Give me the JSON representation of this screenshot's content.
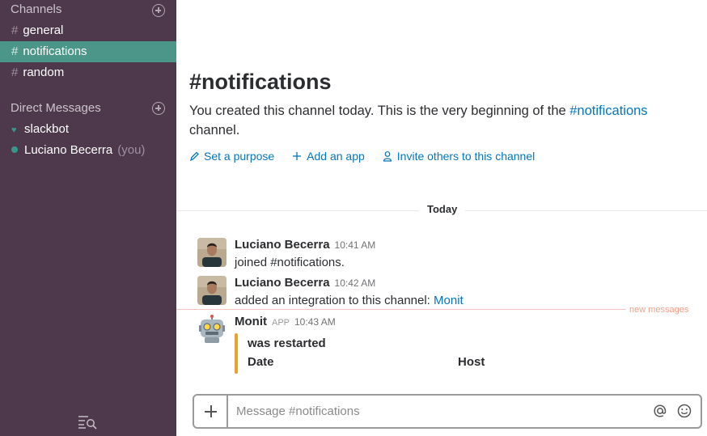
{
  "sidebar": {
    "channels_header": "Channels",
    "channels": [
      {
        "label": "general",
        "active": false
      },
      {
        "label": "notifications",
        "active": true
      },
      {
        "label": "random",
        "active": false
      }
    ],
    "dm_header": "Direct Messages",
    "dms": [
      {
        "label": "slackbot",
        "status_icon": "heart-icon"
      },
      {
        "label": "Luciano Becerra",
        "suffix": "(you)",
        "status_icon": "presence-dot-icon"
      }
    ],
    "quick_switcher_icon": "search-list-icon"
  },
  "channel": {
    "title": "#notifications",
    "intro_prefix": "You created this channel today. This is the very beginning of the ",
    "intro_link": "#notifications",
    "intro_suffix": "channel.",
    "actions": [
      {
        "label": "Set a purpose",
        "icon": "pencil-icon"
      },
      {
        "label": "Add an app",
        "icon": "plus-icon"
      },
      {
        "label": "Invite others to this channel",
        "icon": "person-icon"
      }
    ]
  },
  "day_divider": "Today",
  "messages": [
    {
      "sender": "Luciano Becerra",
      "time": "10:41 AM",
      "text": "joined #notifications."
    },
    {
      "sender": "Luciano Becerra",
      "time": "10:42 AM",
      "text": "added an integration to this channel: ",
      "link": "Monit"
    },
    {
      "sender": "Monit",
      "badge": "APP",
      "time": "10:43 AM",
      "attachment": {
        "title": "was restarted",
        "fields": [
          "Date",
          "Host"
        ],
        "color": "#e8a22e"
      }
    }
  ],
  "new_messages_label": "new messages",
  "composer": {
    "placeholder": "Message #notifications"
  },
  "colors": {
    "sidebar_bg": "#4d394b",
    "active_channel": "#4c9689",
    "link": "#0576b9",
    "new_messages": "#f0a08a"
  }
}
